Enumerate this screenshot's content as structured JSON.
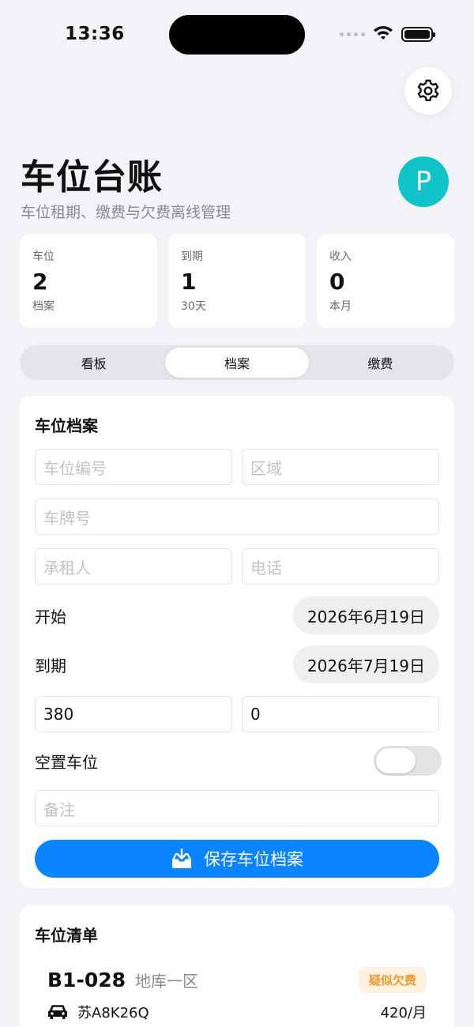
{
  "status_bar": {
    "time": "13:36"
  },
  "header": {
    "title": "车位台账",
    "subtitle": "车位租期、缴费与欠费离线管理",
    "avatar_letter": "P"
  },
  "stats": [
    {
      "label": "车位",
      "value": "2",
      "sub": "档案"
    },
    {
      "label": "到期",
      "value": "1",
      "sub": "30天"
    },
    {
      "label": "收入",
      "value": "0",
      "sub": "本月"
    }
  ],
  "tabs": [
    {
      "label": "看板",
      "active": false
    },
    {
      "label": "档案",
      "active": true
    },
    {
      "label": "缴费",
      "active": false
    }
  ],
  "form": {
    "title": "车位档案",
    "space_code_placeholder": "车位编号",
    "zone_placeholder": "区域",
    "plate_placeholder": "车牌号",
    "tenant_placeholder": "承租人",
    "phone_placeholder": "电话",
    "start_label": "开始",
    "start_date": "2026年6月19日",
    "end_label": "到期",
    "end_date": "2026年7月19日",
    "rent_value": "380",
    "deposit_value": "0",
    "vacant_label": "空置车位",
    "vacant_on": false,
    "note_placeholder": "备注",
    "save_label": "保存车位档案"
  },
  "list": {
    "title": "车位清单",
    "items": [
      {
        "code": "B1-028",
        "zone": "地库一区",
        "badge": "疑似欠费",
        "plate": "苏A8K26Q",
        "rent": "420/月"
      }
    ]
  },
  "colors": {
    "accent": "#0a84ff",
    "avatar": "#10c3c8",
    "badge_text": "#f39a2a",
    "badge_bg": "#fff1df",
    "background": "#f2f2f7"
  }
}
